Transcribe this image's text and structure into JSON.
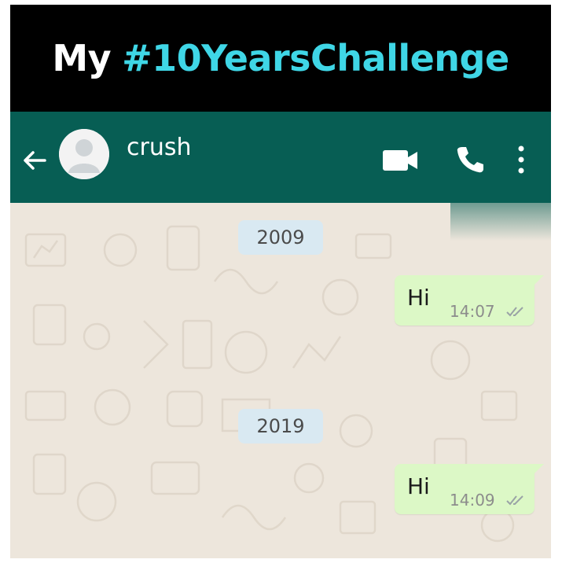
{
  "banner": {
    "word": "My",
    "hashtag": "#10YearsChallenge",
    "colors": {
      "word": "#ffffff",
      "hashtag": "#3fd6e6",
      "background": "#000000"
    }
  },
  "header": {
    "contact_name": "crush",
    "color": "#075e54",
    "icons": [
      "back-arrow-icon",
      "avatar",
      "video-call-icon",
      "phone-call-icon",
      "more-options-icon"
    ]
  },
  "chat": {
    "background_color": "#ede6dc",
    "items": [
      {
        "type": "date",
        "label": "2009"
      },
      {
        "type": "message",
        "direction": "outgoing",
        "text": "Hi",
        "time": "14:07",
        "status": "read-ticks"
      },
      {
        "type": "date",
        "label": "2019"
      },
      {
        "type": "message",
        "direction": "outgoing",
        "text": "Hi",
        "time": "14:09",
        "status": "read-ticks"
      }
    ],
    "colors": {
      "outgoing_bubble": "#dcf8c6",
      "date_chip": "#d9e9f2"
    }
  }
}
